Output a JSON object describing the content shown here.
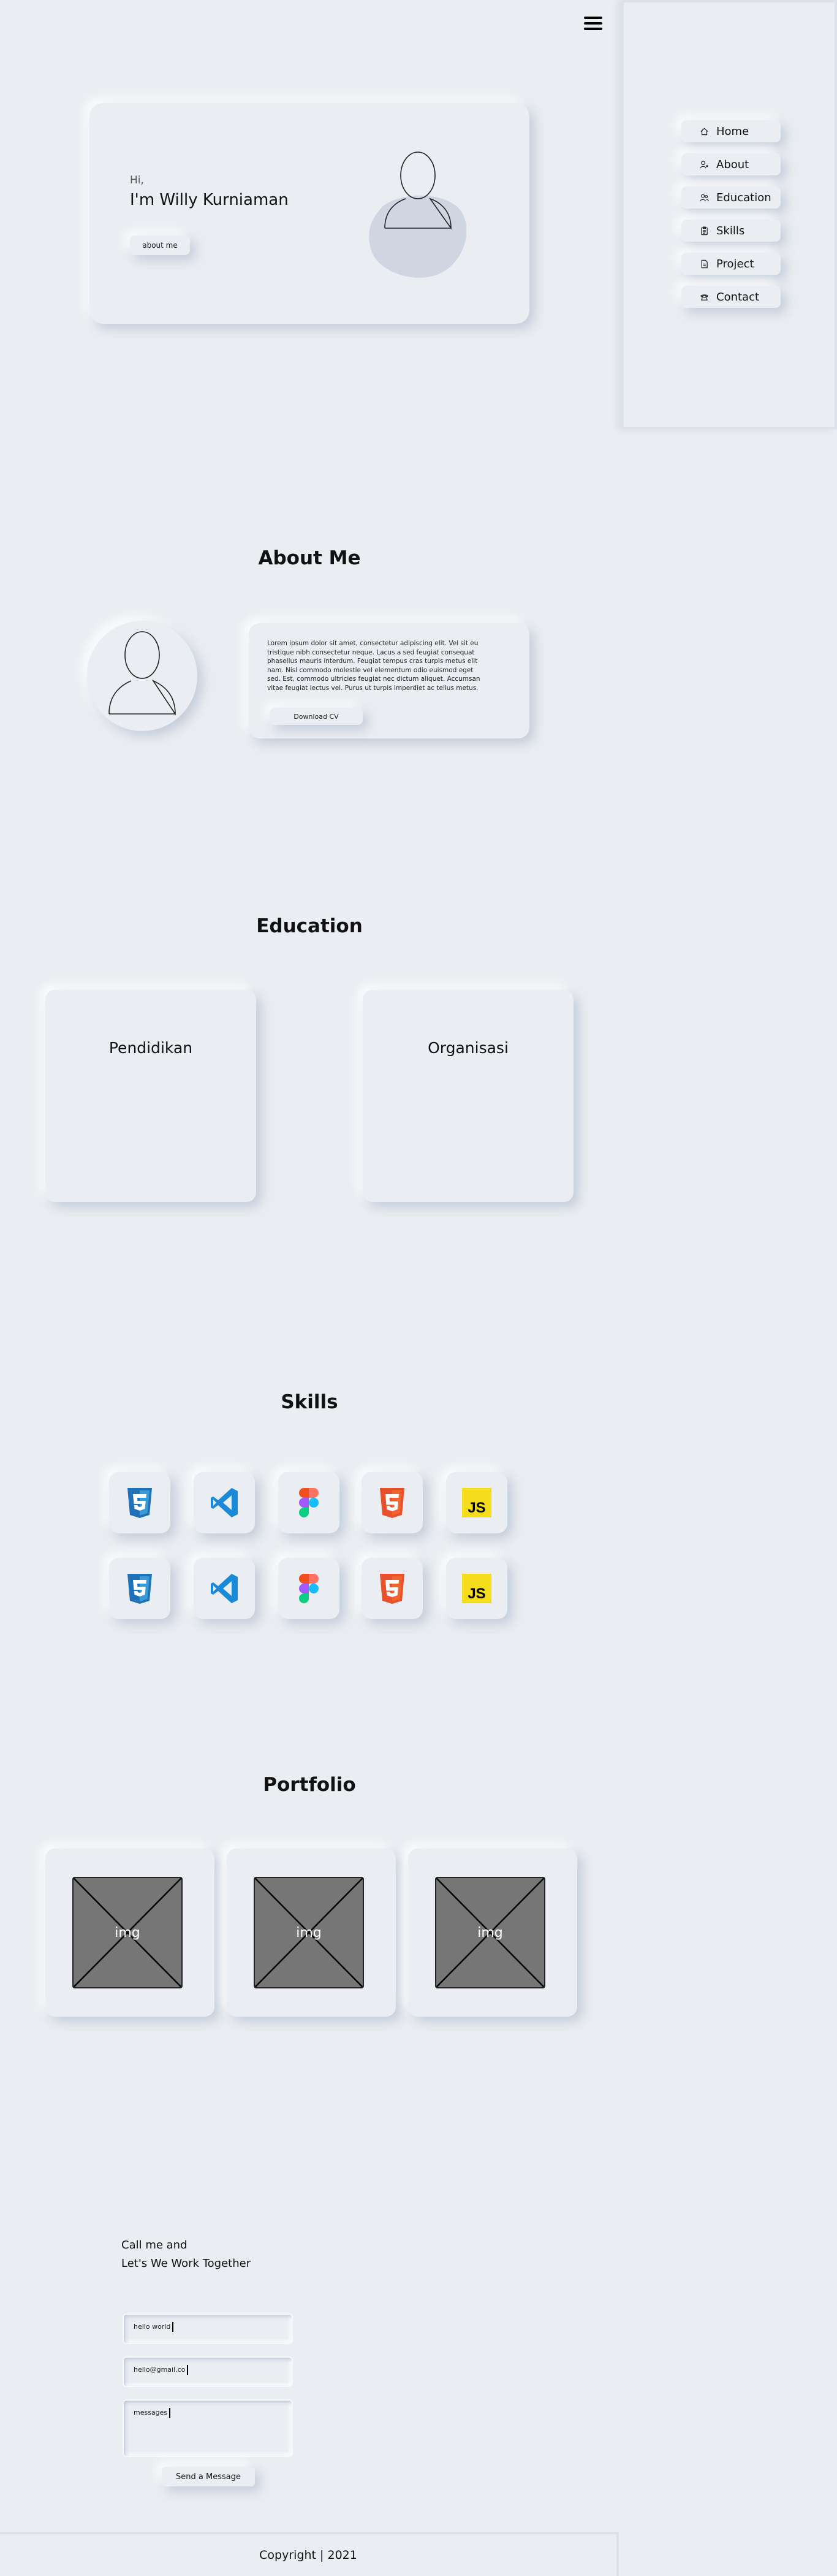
{
  "nav": {
    "items": [
      {
        "label": "Home",
        "icon": "home-icon"
      },
      {
        "label": "About",
        "icon": "user-icon"
      },
      {
        "label": "Education",
        "icon": "people-icon"
      },
      {
        "label": "Skills",
        "icon": "clipboard-icon"
      },
      {
        "label": "Project",
        "icon": "file-icon"
      },
      {
        "label": "Contact",
        "icon": "telephone-icon"
      }
    ]
  },
  "hero": {
    "greeting": "Hi,",
    "name": "I'm Willy Kurniaman",
    "button": "about me"
  },
  "about": {
    "title": "About Me",
    "text": "Lorem ipsum dolor sit amet, consectetur adipiscing elit. Vel sit eu tristique nibh consectetur neque. Lacus a sed feugiat consequat phasellus mauris interdum. Feugiat tempus cras turpis metus elit nam. Nisl commodo molestie vel elementum odio euismod eget sed. Est, commodo ultricies feugiat nec dictum aliquet. Accumsan vitae feugiat lectus vel. Purus ut turpis imperdiet ac tellus metus.",
    "button": "Download CV"
  },
  "education": {
    "title": "Education",
    "cards": [
      "Pendidikan",
      "Organisasi"
    ]
  },
  "skills": {
    "title": "Skills",
    "icons": [
      "css3-icon",
      "vscode-icon",
      "figma-icon",
      "html5-icon",
      "javascript-icon"
    ],
    "js_label": "JS",
    "colors": {
      "css": "#1f72b8",
      "vscode": "#1a8ad8",
      "html": "#e8512b",
      "js": "#f5dd1e"
    }
  },
  "portfolio": {
    "title": "Portfolio",
    "items": [
      "img",
      "img",
      "img"
    ]
  },
  "contact": {
    "heading_line1": "Call me and",
    "heading_line2": "Let's We Work Together",
    "name_value": "hello world",
    "email_value": "hello@gmail.co",
    "message_value": "messages",
    "send_button": "Send a Message"
  },
  "footer": {
    "copyright": "Copyright | 2021"
  }
}
